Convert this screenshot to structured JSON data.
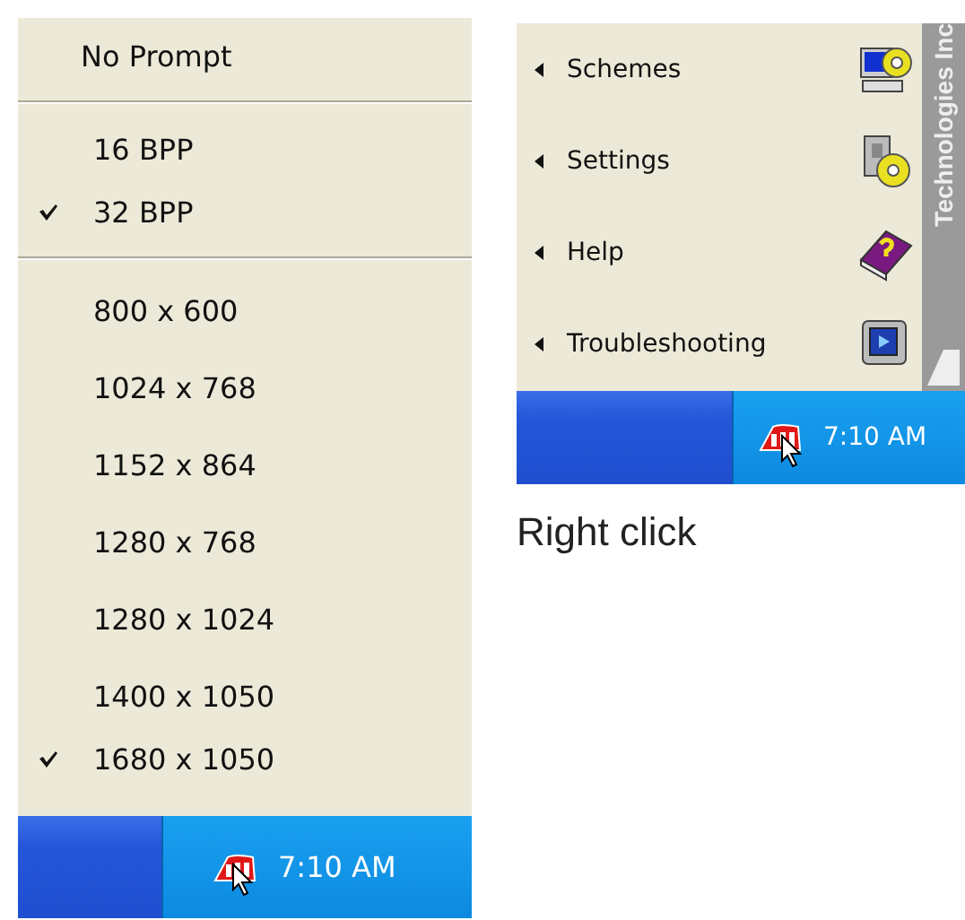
{
  "resolution_menu": {
    "sections": [
      {
        "items": [
          {
            "label": "No Prompt",
            "checked": false
          }
        ]
      },
      {
        "items": [
          {
            "label": "16 BPP",
            "checked": false
          },
          {
            "label": "32 BPP",
            "checked": true
          }
        ]
      },
      {
        "items": [
          {
            "label": "800 x 600",
            "checked": false
          },
          {
            "label": "1024 x 768",
            "checked": false
          },
          {
            "label": "1152 x 864",
            "checked": false
          },
          {
            "label": "1280 x 768",
            "checked": false
          },
          {
            "label": "1280 x 1024",
            "checked": false
          },
          {
            "label": "1400 x 1050",
            "checked": false
          },
          {
            "label": "1680 x 1050",
            "checked": true
          }
        ]
      }
    ]
  },
  "left_taskbar": {
    "clock": "7:10 AM"
  },
  "tray_menu": {
    "items": [
      {
        "label": "Schemes"
      },
      {
        "label": "Settings"
      },
      {
        "label": "Help"
      },
      {
        "label": "Troubleshooting"
      }
    ],
    "side_banner": "Technologies Inc"
  },
  "right_taskbar": {
    "clock": "7:10 AM"
  },
  "caption": "Right click"
}
